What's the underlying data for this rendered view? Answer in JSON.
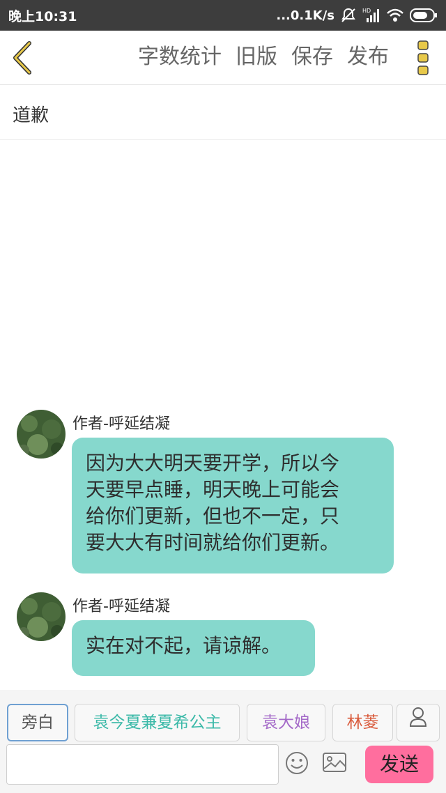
{
  "status_bar": {
    "time": "晚上10:31",
    "network_speed": "...0.1K/s",
    "icons": [
      "mute-icon",
      "hd-signal-icon",
      "wifi-icon",
      "battery-icon"
    ]
  },
  "toolbar": {
    "back_icon": "chevron-left-icon",
    "actions": [
      "字数统计",
      "旧版",
      "保存",
      "发布"
    ],
    "more_icon": "more-vertical-icon",
    "accent_color": "#e8c94a"
  },
  "chapter_title": "道歉",
  "messages": [
    {
      "author": "作者-呼延结凝",
      "text": "因为大大明天要开学，所以今天要早点睡，明天晚上可能会给你们更新，但也不一定，只要大大有时间就给你们更新。",
      "lines": [
        "因为大大明天要开学，所以今",
        "天要早点睡，明天晚上可能会",
        "给你们更新，但也不一定，只",
        "要大大有时间就给你们更新。"
      ]
    },
    {
      "author": "作者-呼延结凝",
      "text": "实在对不起，请谅解。",
      "lines": [
        "实在对不起，请谅解。"
      ]
    }
  ],
  "bubble_color": "#86d8cd",
  "characters": [
    {
      "name": "旁白",
      "color": "#555555",
      "selected": true
    },
    {
      "name": "袁今夏兼夏希公主",
      "color": "#3bb9a8",
      "selected": false
    },
    {
      "name": "袁大娘",
      "color": "#a46ac8",
      "selected": false
    },
    {
      "name": "林菱",
      "color": "#d95a3b",
      "selected": false
    }
  ],
  "add_character_icon": "person-icon",
  "composer": {
    "input_value": "",
    "emoji_icon": "smiley-icon",
    "image_icon": "image-icon",
    "send_label": "发送",
    "send_color": "#ff6e9e"
  }
}
